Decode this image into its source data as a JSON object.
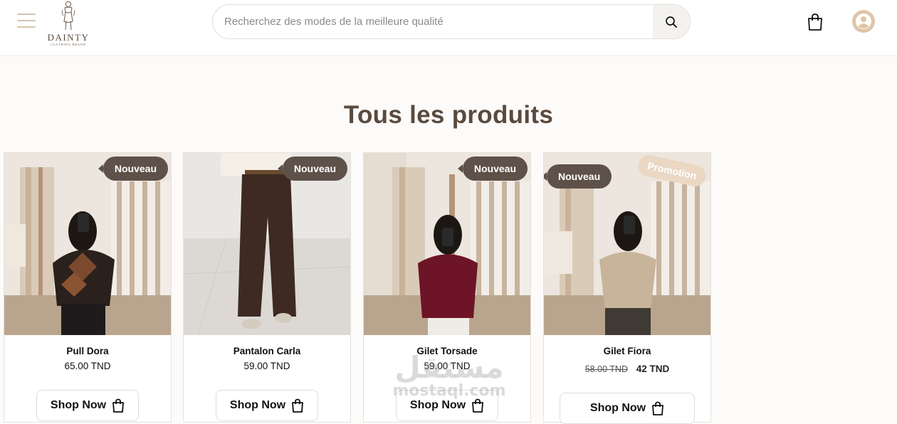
{
  "header": {
    "brand_name": "DAINTY",
    "brand_tagline": "CLOTHING BRAND",
    "search_placeholder": "Recherchez des modes de la meilleure qualité",
    "icons": {
      "menu": "hamburger-icon",
      "search": "search-icon",
      "cart": "shopping-bag-icon",
      "user": "user-circle-icon"
    },
    "accent_color": "#d7c3ad"
  },
  "main": {
    "title": "Tous les produits",
    "products": [
      {
        "name": "Pull Dora",
        "price": "65.00 TND",
        "badge": "Nouveau",
        "button": "Shop Now"
      },
      {
        "name": "Pantalon Carla",
        "price": "59.00 TND",
        "badge": "Nouveau",
        "button": "Shop Now"
      },
      {
        "name": "Gilet Torsade",
        "price": "59.00 TND",
        "badge": "Nouveau",
        "button": "Shop Now"
      },
      {
        "name": "Gilet Fiora",
        "old_price": "58.00 TND",
        "price": "42 TND",
        "badge": "Nouveau",
        "promo_badge": "Promotion",
        "button": "Shop Now"
      }
    ]
  },
  "watermark": {
    "arabic": "مستقل",
    "latin": "mostaql.com"
  }
}
